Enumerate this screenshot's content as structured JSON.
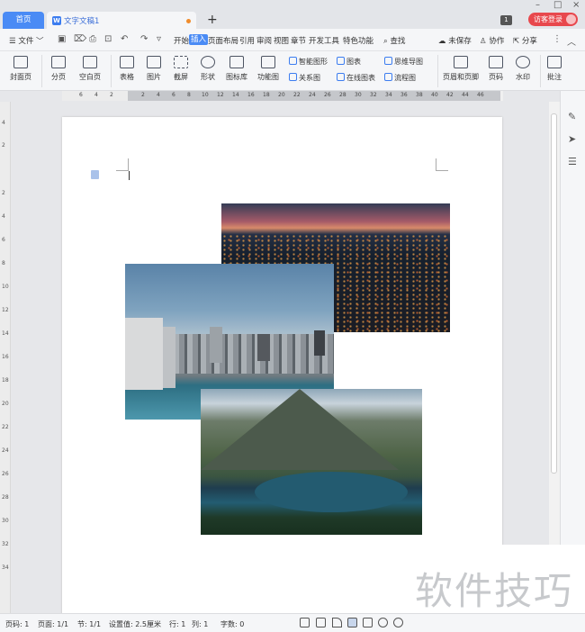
{
  "titlebar": {
    "home_tab": "首页",
    "doc_tab": "文字文稿1",
    "add_tab": "+",
    "badge": "1",
    "login": "访客登录",
    "minimize": "–",
    "maximize": "□",
    "close": "×"
  },
  "menu": {
    "file": "☰ 文件 ﹀",
    "items": [
      "开始",
      "插入",
      "页面布局",
      "引用",
      "审阅",
      "视图",
      "章节",
      "开发工具",
      "特色功能"
    ],
    "search": "查找",
    "unsaved": "未保存",
    "collab": "协作",
    "share": "分享"
  },
  "ribbon": {
    "cover": "封面页",
    "page_break": "分页",
    "blank": "空白页",
    "table": "表格",
    "image": "图片",
    "screenshot": "截屏",
    "shape": "形状",
    "icon_lib": "图标库",
    "func_chart": "功能图",
    "smart_shape": "智能图形",
    "chart": "图表",
    "mind_map": "思维导图",
    "relation": "关系图",
    "online_chart": "在线图表",
    "flowchart": "流程图",
    "header_footer": "页眉和页脚",
    "page_num": "页码",
    "watermark_btn": "水印",
    "comment": "批注"
  },
  "ruler": {
    "h_marks": [
      "6",
      "4",
      "2",
      "2",
      "4",
      "6",
      "8",
      "10",
      "12",
      "14",
      "16",
      "18",
      "20",
      "22",
      "24",
      "26",
      "28",
      "30",
      "32",
      "34",
      "36",
      "38",
      "40",
      "42",
      "44",
      "46"
    ],
    "v_marks": [
      "4",
      "2",
      "2",
      "4",
      "6",
      "8",
      "10",
      "12",
      "14",
      "16",
      "18",
      "20",
      "22",
      "24",
      "26",
      "28",
      "30",
      "32",
      "34"
    ]
  },
  "status": {
    "page_code": "页码: 1",
    "pages": "页面: 1/1",
    "section": "节: 1/1",
    "setting": "设置值: 2.5厘米",
    "row": "行: 1",
    "col": "列: 1",
    "words": "字数: 0"
  },
  "watermark_text": "软件技巧",
  "colors": {
    "accent": "#4a8bf5",
    "login": "#e8484d"
  }
}
